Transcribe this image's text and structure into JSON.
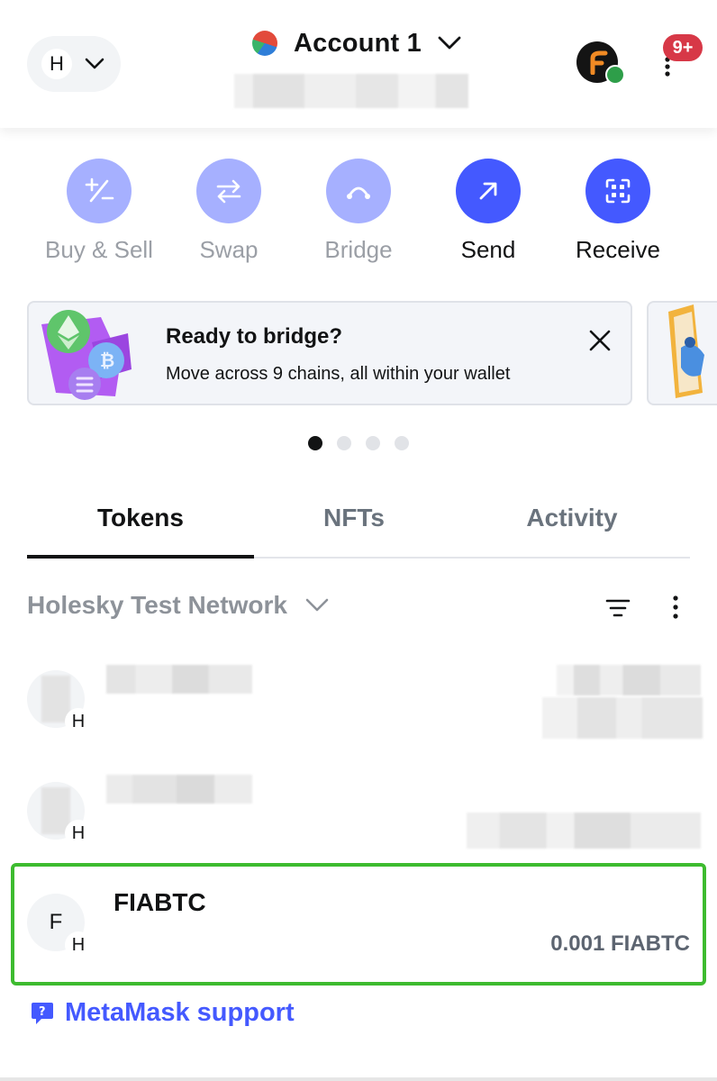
{
  "header": {
    "network_initial": "H",
    "account_name": "Account 1",
    "notification_count": "9+"
  },
  "actions": [
    {
      "label": "Buy & Sell",
      "enabled": false
    },
    {
      "label": "Swap",
      "enabled": false
    },
    {
      "label": "Bridge",
      "enabled": false
    },
    {
      "label": "Send",
      "enabled": true
    },
    {
      "label": "Receive",
      "enabled": true
    }
  ],
  "banner": {
    "title": "Ready to bridge?",
    "text": "Move across 9 chains, all within your wallet"
  },
  "carousel": {
    "total": 4,
    "active_index": 0
  },
  "tabs": [
    "Tokens",
    "NFTs",
    "Activity"
  ],
  "active_tab": "Tokens",
  "filter": {
    "network_label": "Holesky Test Network"
  },
  "tokens": [
    {
      "initial": "",
      "network_initial": "H",
      "name": "",
      "balance": ""
    },
    {
      "initial": "",
      "network_initial": "H",
      "name": "",
      "balance": ""
    },
    {
      "initial": "F",
      "network_initial": "H",
      "name": "FIABTC",
      "balance": "0.001 FIABTC"
    }
  ],
  "support": {
    "label": "MetaMask support"
  },
  "colors": {
    "accent": "#4459ff",
    "accent_disabled": "#a6b0ff",
    "highlight": "#3dbb2f",
    "badge": "#d73847"
  }
}
